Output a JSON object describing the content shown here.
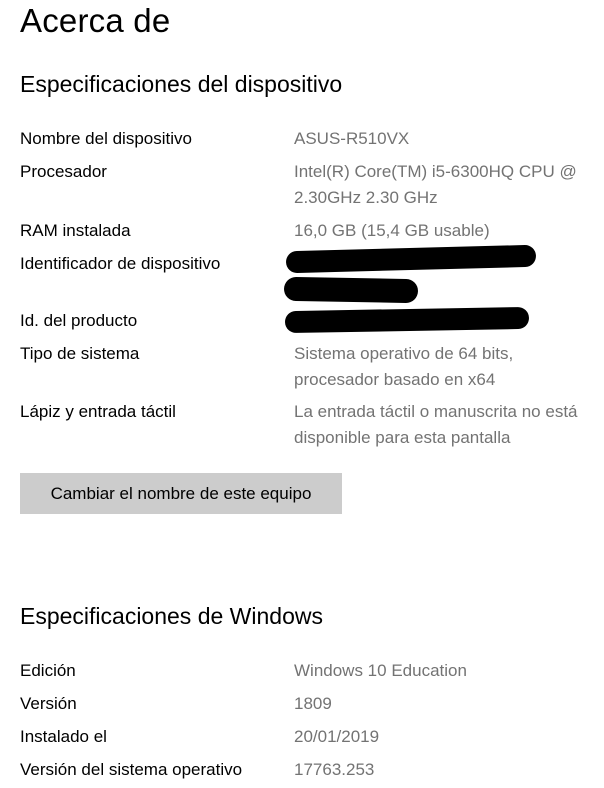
{
  "page": {
    "title": "Acerca de"
  },
  "device_specs": {
    "heading": "Especificaciones del dispositivo",
    "rows": [
      {
        "label": "Nombre del dispositivo",
        "value": "ASUS-R510VX"
      },
      {
        "label": "Procesador",
        "value": "Intel(R) Core(TM) i5-6300HQ CPU @ 2.30GHz   2.30 GHz"
      },
      {
        "label": "RAM instalada",
        "value": "16,0 GB (15,4 GB usable)"
      },
      {
        "label": "Identificador de dispositivo",
        "value": ""
      },
      {
        "label": "Id. del producto",
        "value": ""
      },
      {
        "label": "Tipo de sistema",
        "value": "Sistema operativo de 64 bits, procesador basado en x64"
      },
      {
        "label": "Lápiz y entrada táctil",
        "value": "La entrada táctil o manuscrita no está disponible para esta pantalla"
      }
    ],
    "rename_button_label": "Cambiar el nombre de este equipo"
  },
  "windows_specs": {
    "heading": "Especificaciones de Windows",
    "rows": [
      {
        "label": "Edición",
        "value": "Windows 10 Education"
      },
      {
        "label": "Versión",
        "value": "1809"
      },
      {
        "label": "Instalado el",
        "value": "20/01/2019"
      },
      {
        "label": "Versión del sistema operativo",
        "value": "17763.253"
      }
    ]
  }
}
